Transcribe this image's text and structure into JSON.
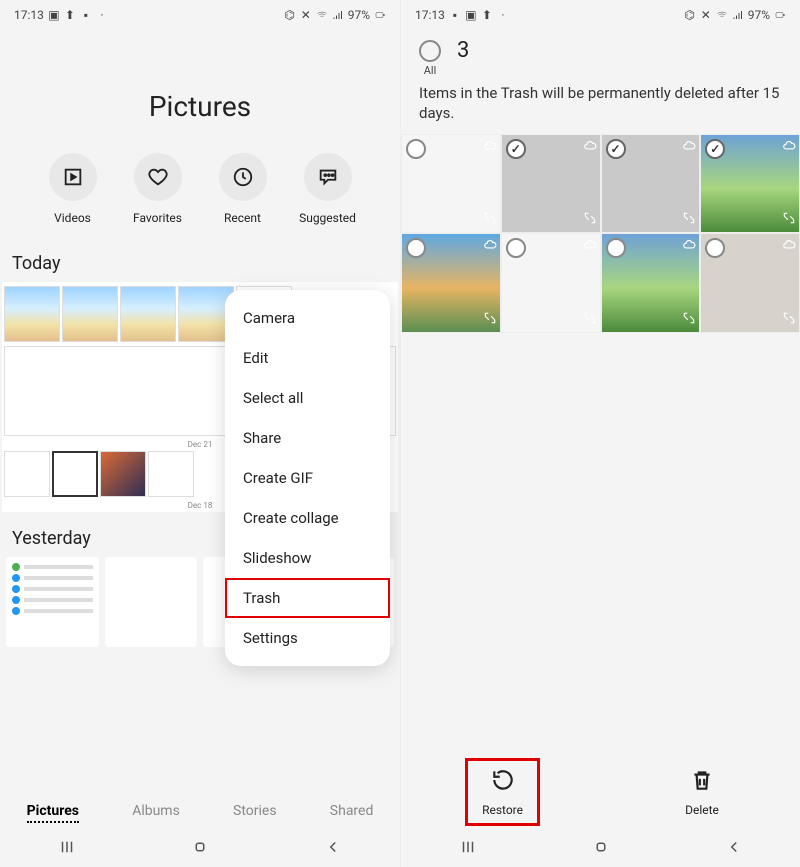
{
  "status": {
    "time": "17:13",
    "battery_pct": "97%"
  },
  "left": {
    "title": "Pictures",
    "quick": [
      "Videos",
      "Favorites",
      "Recent",
      "Suggested"
    ],
    "sections": {
      "today": "Today",
      "yesterday": "Yesterday"
    },
    "row_dates": {
      "d1": "Dec 21",
      "d2": "Dec 18"
    },
    "tabs": [
      "Pictures",
      "Albums",
      "Stories",
      "Shared"
    ],
    "active_tab": 0,
    "menu": [
      "Camera",
      "Edit",
      "Select all",
      "Share",
      "Create GIF",
      "Create collage",
      "Slideshow",
      "Trash",
      "Settings"
    ],
    "menu_highlight_index": 7
  },
  "right": {
    "all_label": "All",
    "selected_count": "3",
    "message": "Items in the Trash will be permanently deleted after 15 days.",
    "thumbs": [
      {
        "selected": false,
        "kind": "settings"
      },
      {
        "selected": true,
        "kind": "gray"
      },
      {
        "selected": true,
        "kind": "gray"
      },
      {
        "selected": true,
        "kind": "landscape"
      },
      {
        "selected": false,
        "kind": "sunset"
      },
      {
        "selected": false,
        "kind": "settings"
      },
      {
        "selected": false,
        "kind": "landscape"
      },
      {
        "selected": false,
        "kind": "door"
      }
    ],
    "actions": {
      "restore": "Restore",
      "delete": "Delete"
    },
    "highlight_action": "restore"
  }
}
